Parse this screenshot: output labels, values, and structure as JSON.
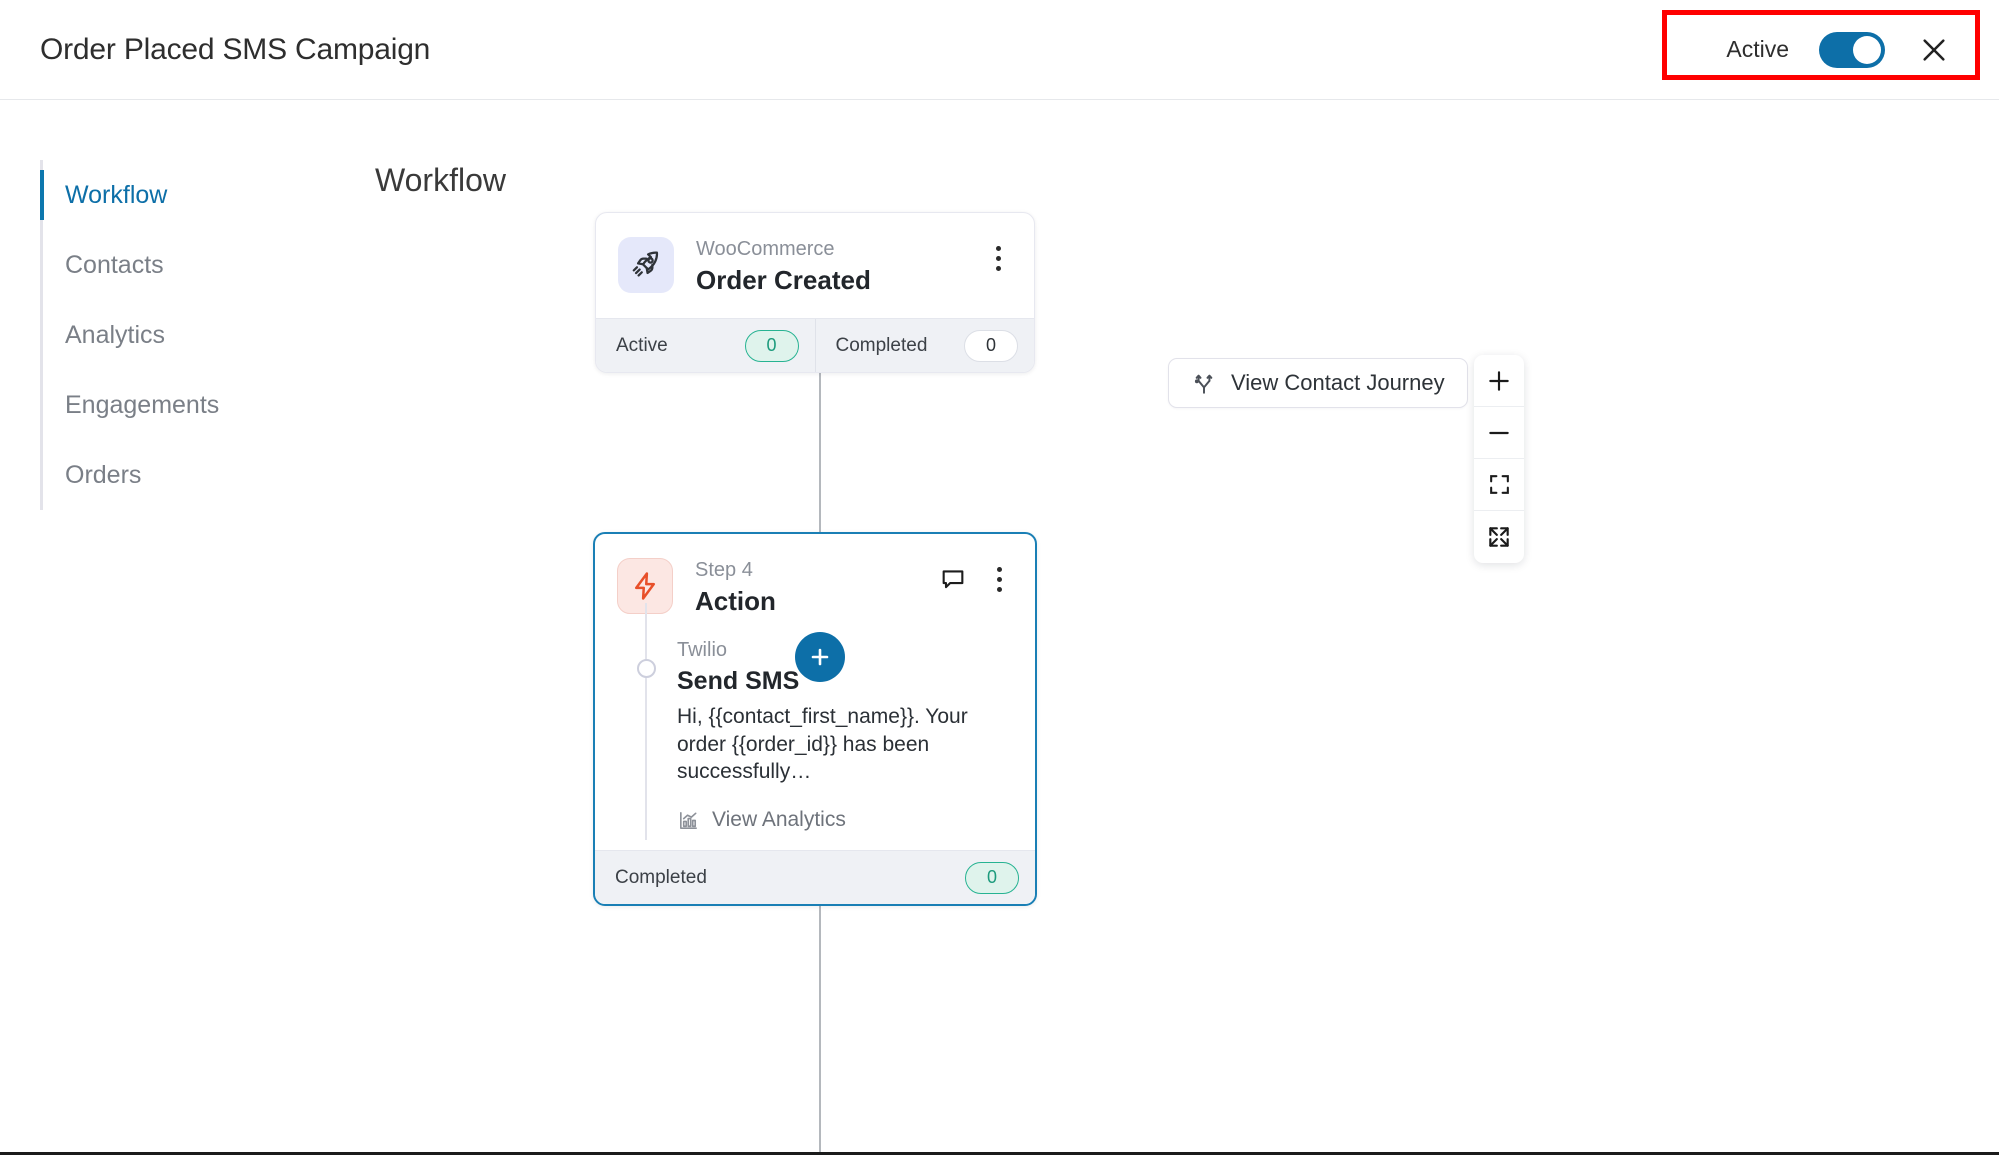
{
  "topbar": {
    "title": "Order Placed SMS Campaign",
    "status_label": "Active",
    "toggle_state": "on",
    "close_label": "×"
  },
  "sidebar": {
    "items": [
      {
        "label": "Workflow",
        "active": true
      },
      {
        "label": "Contacts",
        "active": false
      },
      {
        "label": "Analytics",
        "active": false
      },
      {
        "label": "Engagements",
        "active": false
      },
      {
        "label": "Orders",
        "active": false
      }
    ]
  },
  "canvas": {
    "heading": "Workflow",
    "journey_button": "View Contact Journey",
    "add_node_label": "+",
    "zoom_controls": [
      {
        "name": "zoom-in",
        "label": "+"
      },
      {
        "name": "zoom-out",
        "label": "−"
      },
      {
        "name": "fit-view",
        "label": ""
      },
      {
        "name": "fullscreen",
        "label": ""
      }
    ]
  },
  "trigger_node": {
    "vendor": "WooCommerce",
    "title": "Order Created",
    "icon": "rocket-icon",
    "stats": [
      {
        "label": "Active",
        "value": "0",
        "style": "green"
      },
      {
        "label": "Completed",
        "value": "0",
        "style": "white"
      }
    ]
  },
  "action_node": {
    "step": "Step 4",
    "title": "Action",
    "icon": "lightning-bolt-icon",
    "selected": true,
    "sub_step": {
      "vendor": "Twilio",
      "title": "Send SMS",
      "message": "Hi, {{contact_first_name}}. Your order {{order_id}} has been successfully…",
      "analytics_link": "View Analytics"
    },
    "stats": [
      {
        "label": "Completed",
        "value": "0",
        "style": "green"
      }
    ]
  },
  "colors": {
    "accent_blue": "#0d6fa8",
    "sidebar_active": "#0d77ae",
    "selected_border": "#1a7fb5",
    "pill_green_bg": "#dff3ec",
    "pill_green_border": "#27b392",
    "annotation_red": "#ff0000",
    "bolt_orange": "#e8502a"
  }
}
